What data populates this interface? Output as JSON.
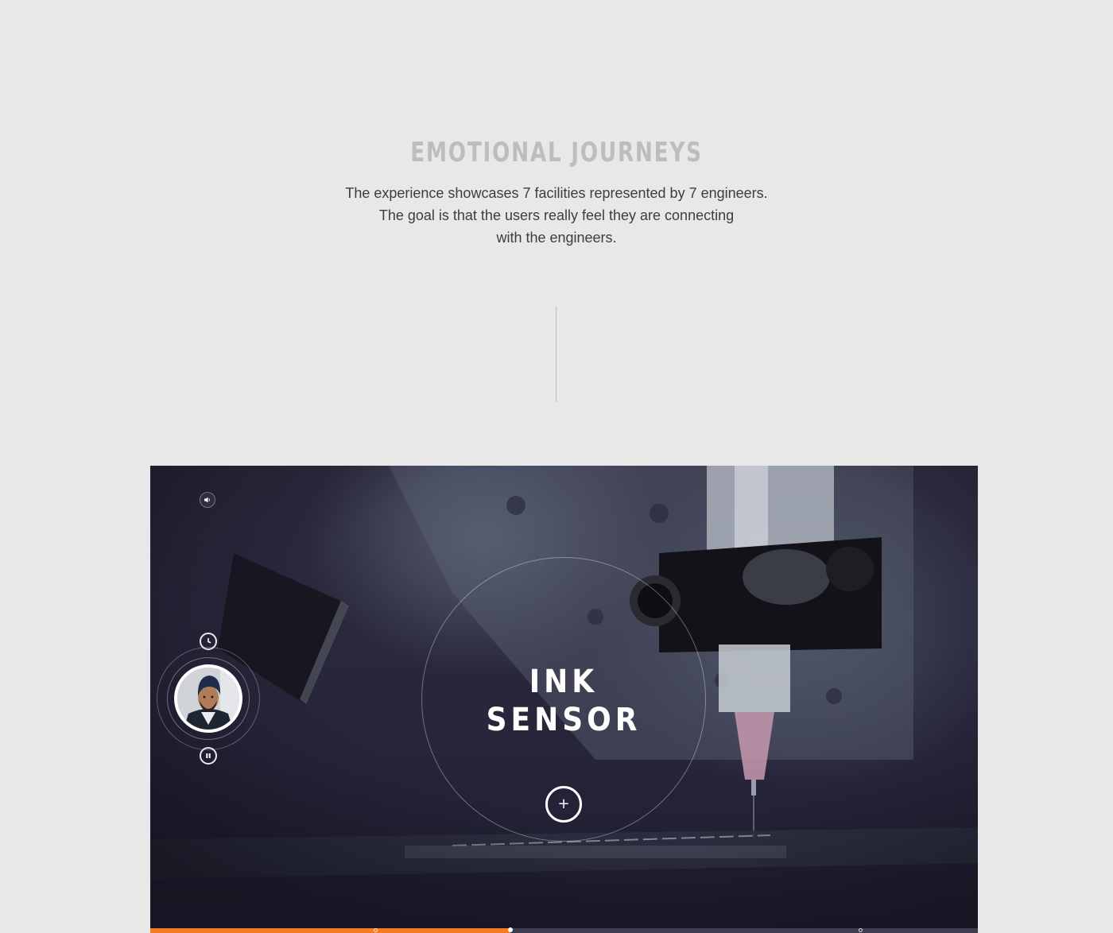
{
  "section": {
    "title": "EMOTIONAL JOURNEYS",
    "description_lines": [
      "The experience showcases 7 facilities represented by 7 engineers.",
      "The goal is that the users really feel they are connecting",
      "with the engineers."
    ]
  },
  "player": {
    "facility_name_line1": "INK",
    "facility_name_line2": "SENSOR",
    "controls": {
      "sound_icon": "speaker-icon",
      "clock_icon": "clock-icon",
      "pause_icon": "pause-icon",
      "plus_icon": "plus-icon",
      "plus_symbol": "+"
    },
    "progress": {
      "played_fraction": 0.435,
      "chapter_marker_fractions": [
        0.272,
        0.858
      ]
    },
    "colors": {
      "accent": "#f47b20",
      "overlay": "#27253a"
    }
  }
}
